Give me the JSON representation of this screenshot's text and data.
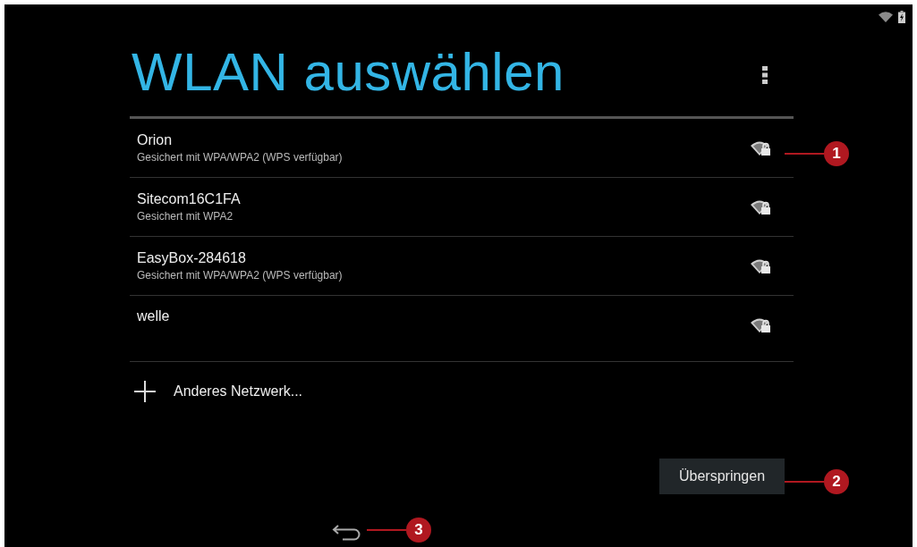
{
  "title": "WLAN auswählen",
  "networks": [
    {
      "name": "Orion",
      "security": "Gesichert mit WPA/WPA2 (WPS verfügbar)"
    },
    {
      "name": "Sitecom16C1FA",
      "security": "Gesichert mit WPA2"
    },
    {
      "name": "EasyBox-284618",
      "security": "Gesichert mit WPA/WPA2 (WPS verfügbar)"
    },
    {
      "name": "welle"
    }
  ],
  "add_network": {
    "label": "Anderes Netzwerk..."
  },
  "skip_button": {
    "label": "Überspringen"
  },
  "callouts": [
    {
      "number": "1"
    },
    {
      "number": "2"
    },
    {
      "number": "3"
    }
  ]
}
